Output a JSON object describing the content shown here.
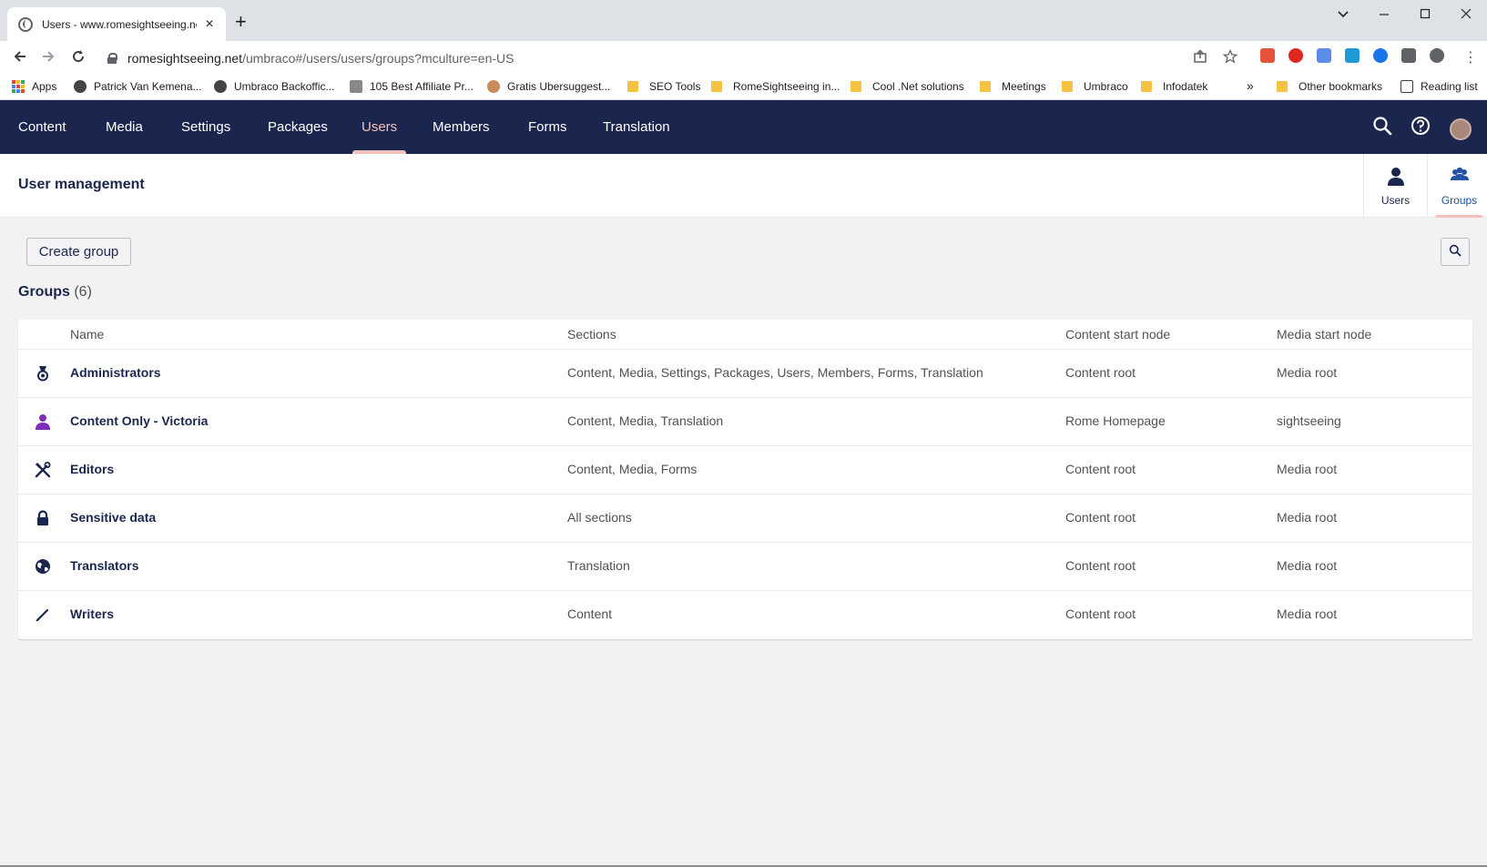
{
  "browser": {
    "tab_title": "Users - www.romesightseeing.ne",
    "tab_close": "×",
    "new_tab": "+",
    "url_host": "romesightseeing.net",
    "url_path": "/umbraco#/users/users/groups?mculture=en-US",
    "bookmarks": [
      {
        "label": "Apps"
      },
      {
        "label": "Patrick Van Kemena..."
      },
      {
        "label": "Umbraco Backoffic..."
      },
      {
        "label": "105 Best Affiliate Pr..."
      },
      {
        "label": "Gratis Ubersuggest..."
      },
      {
        "label": "SEO Tools"
      },
      {
        "label": "RomeSightseeing in..."
      },
      {
        "label": "Cool .Net solutions"
      },
      {
        "label": "Meetings"
      },
      {
        "label": "Umbraco"
      },
      {
        "label": "Infodatek"
      }
    ],
    "more_bookmarks": "»",
    "other_bookmarks": "Other bookmarks",
    "reading_list": "Reading list"
  },
  "umbraco": {
    "sections": [
      "Content",
      "Media",
      "Settings",
      "Packages",
      "Users",
      "Members",
      "Forms",
      "Translation"
    ],
    "active_section": "Users",
    "page_title": "User management",
    "subnav": {
      "users": "Users",
      "groups": "Groups"
    },
    "create_group": "Create group",
    "groups_title": "Groups",
    "groups_count": "(6)",
    "columns": {
      "name": "Name",
      "sections": "Sections",
      "content_start": "Content start node",
      "media_start": "Media start node"
    },
    "groups": [
      {
        "name": "Administrators",
        "sections": "Content, Media, Settings, Packages, Users, Members, Forms, Translation",
        "content_start": "Content root",
        "media_start": "Media root",
        "icon": "medal-icon"
      },
      {
        "name": "Content Only - Victoria",
        "sections": "Content, Media, Translation",
        "content_start": "Rome Homepage",
        "media_start": "sightseeing",
        "icon": "user-icon"
      },
      {
        "name": "Editors",
        "sections": "Content, Media, Forms",
        "content_start": "Content root",
        "media_start": "Media root",
        "icon": "tools-icon"
      },
      {
        "name": "Sensitive data",
        "sections": "All sections",
        "content_start": "Content root",
        "media_start": "Media root",
        "icon": "lock-icon"
      },
      {
        "name": "Translators",
        "sections": "Translation",
        "content_start": "Content root",
        "media_start": "Media root",
        "icon": "globe-icon"
      },
      {
        "name": "Writers",
        "sections": "Content",
        "content_start": "Content root",
        "media_start": "Media root",
        "icon": "pencil-icon"
      }
    ]
  },
  "colors": {
    "nav_bg": "#1b264f",
    "accent": "#f5c1bc",
    "text_dark": "#1b264f",
    "text_muted": "#515054",
    "page_bg": "#f3f1f1"
  }
}
